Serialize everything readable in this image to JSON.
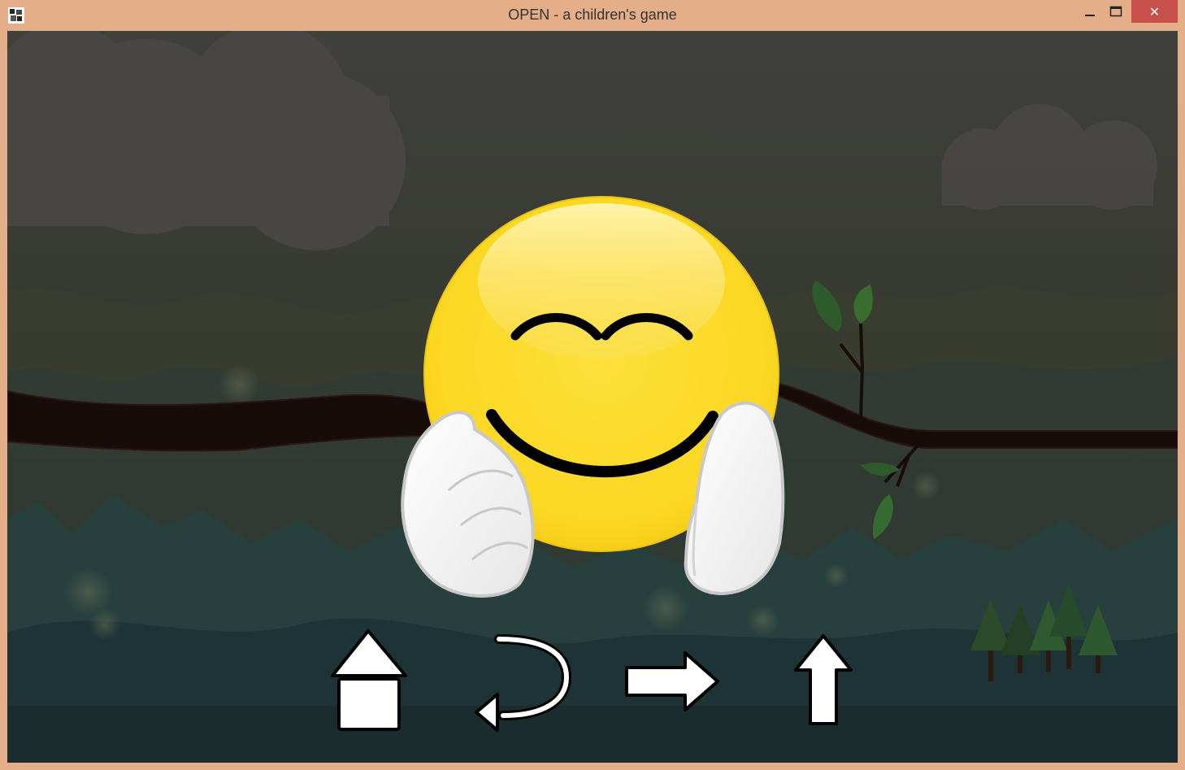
{
  "window": {
    "title": "OPEN - a children's game",
    "app_icon": "app-icon",
    "minimize_icon": "minimize-icon",
    "maximize_icon": "maximize-icon",
    "close_icon": "close-icon",
    "close_glyph": "✕"
  },
  "scene": {
    "background": "night-forest-with-branch",
    "character": "smiling-emoji-with-white-gloves",
    "colors": {
      "sky_top": "#3e3e3c",
      "sky_bottom": "#2b3a34",
      "emoji_yellow": "#fbd722",
      "branch": "#1a0e0c",
      "leaf": "#2f5a2b"
    }
  },
  "controls": [
    {
      "name": "home-button",
      "icon": "home-arrow-icon"
    },
    {
      "name": "undo-button",
      "icon": "undo-curved-arrow-icon"
    },
    {
      "name": "next-button",
      "icon": "right-arrow-icon"
    },
    {
      "name": "up-button",
      "icon": "up-arrow-icon"
    }
  ]
}
